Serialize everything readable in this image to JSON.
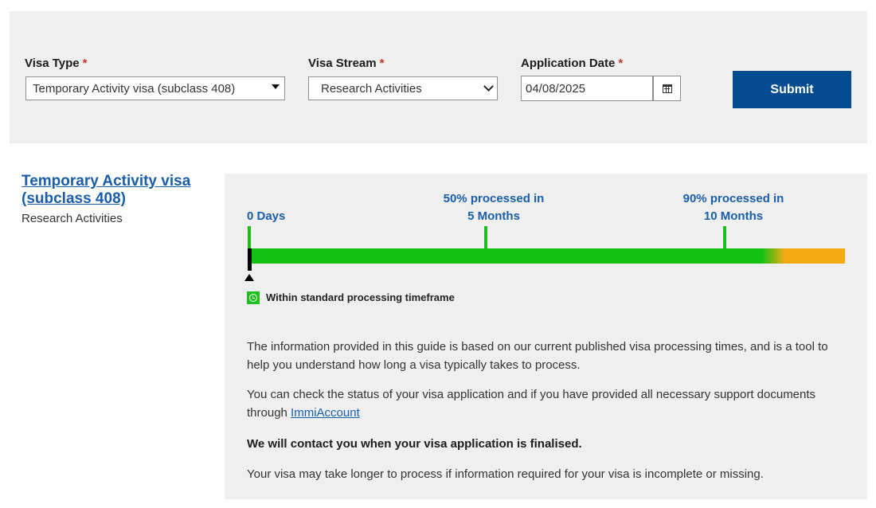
{
  "form": {
    "visa_type": {
      "label": "Visa Type",
      "required_mark": "*",
      "selected": "Temporary Activity visa (subclass 408)"
    },
    "visa_stream": {
      "label": "Visa Stream",
      "required_mark": "*",
      "selected": "Research Activities"
    },
    "application_date": {
      "label": "Application Date",
      "required_mark": "*",
      "value": "04/08/2025"
    },
    "submit_label": "Submit"
  },
  "result": {
    "title": "Temporary Activity visa (subclass 408)",
    "subtitle": "Research Activities",
    "timeline": {
      "start_label": "0 Days",
      "ms50_line1": "50% processed in",
      "ms50_line2": "5 Months",
      "ms90_line1": "90% processed in",
      "ms90_line2": "10 Months",
      "current_position_fraction": 0.0
    },
    "status_text": "Within standard processing timeframe",
    "para1": "The information provided in this guide is based on our current published visa processing times, and is a tool to help you understand how long a visa typically takes to process.",
    "para2_prefix": "You can check the status of your visa application and if you have provided all necessary support documents through ",
    "para2_link": "ImmiAccount",
    "para3": "We will contact you when your visa application is finalised.",
    "para4": "Your visa may take longer to process if information required for your visa is incomplete or missing."
  },
  "icons": {
    "visa_type_caret": "caret-down-icon",
    "visa_stream_chevron": "chevron-down-icon",
    "date_picker": "calendar-icon",
    "status": "clock-icon",
    "marker": "triangle-up-icon"
  },
  "colors": {
    "accent_blue": "#054b8f",
    "link_blue": "#1a5ea8",
    "progress_green": "#12c112",
    "progress_orange": "#f6aa12",
    "required_red": "#c0392b"
  }
}
